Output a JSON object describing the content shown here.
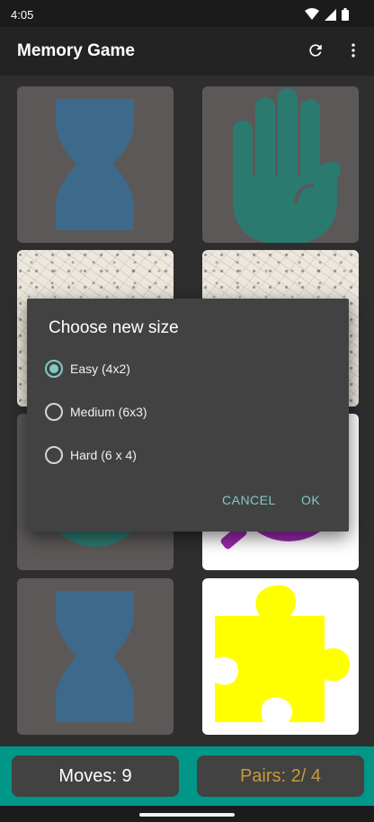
{
  "status_bar": {
    "time": "4:05"
  },
  "app_bar": {
    "title": "Memory Game",
    "refresh_icon": "refresh-icon",
    "menu_icon": "more-vert-icon"
  },
  "board": {
    "cards": [
      {
        "state": "revealed",
        "symbol": "hourglass",
        "color": "#3d6a8b"
      },
      {
        "state": "revealed",
        "symbol": "hand",
        "color": "#2b7a70"
      },
      {
        "state": "face-down",
        "pattern": "floral"
      },
      {
        "state": "face-down",
        "pattern": "floral"
      },
      {
        "state": "revealed",
        "symbol": "circle",
        "color": "#2b7a70"
      },
      {
        "state": "revealed",
        "symbol": "magnifier",
        "color": "#9b27af"
      },
      {
        "state": "revealed",
        "symbol": "hourglass",
        "color": "#3d6a8b"
      },
      {
        "state": "revealed",
        "symbol": "puzzle",
        "color": "#ffff00"
      }
    ]
  },
  "dialog": {
    "title": "Choose new size",
    "options": [
      {
        "label": "Easy (4x2)",
        "checked": true
      },
      {
        "label": "Medium (6x3)",
        "checked": false
      },
      {
        "label": "Hard (6 x 4)",
        "checked": false
      }
    ],
    "cancel_label": "CANCEL",
    "ok_label": "OK"
  },
  "footer": {
    "moves_text": "Moves: 9",
    "pairs_text": "Pairs: 2/ 4",
    "moves_color": "#ffffff",
    "pairs_color": "#c79a3a",
    "bar_color": "#009688"
  }
}
